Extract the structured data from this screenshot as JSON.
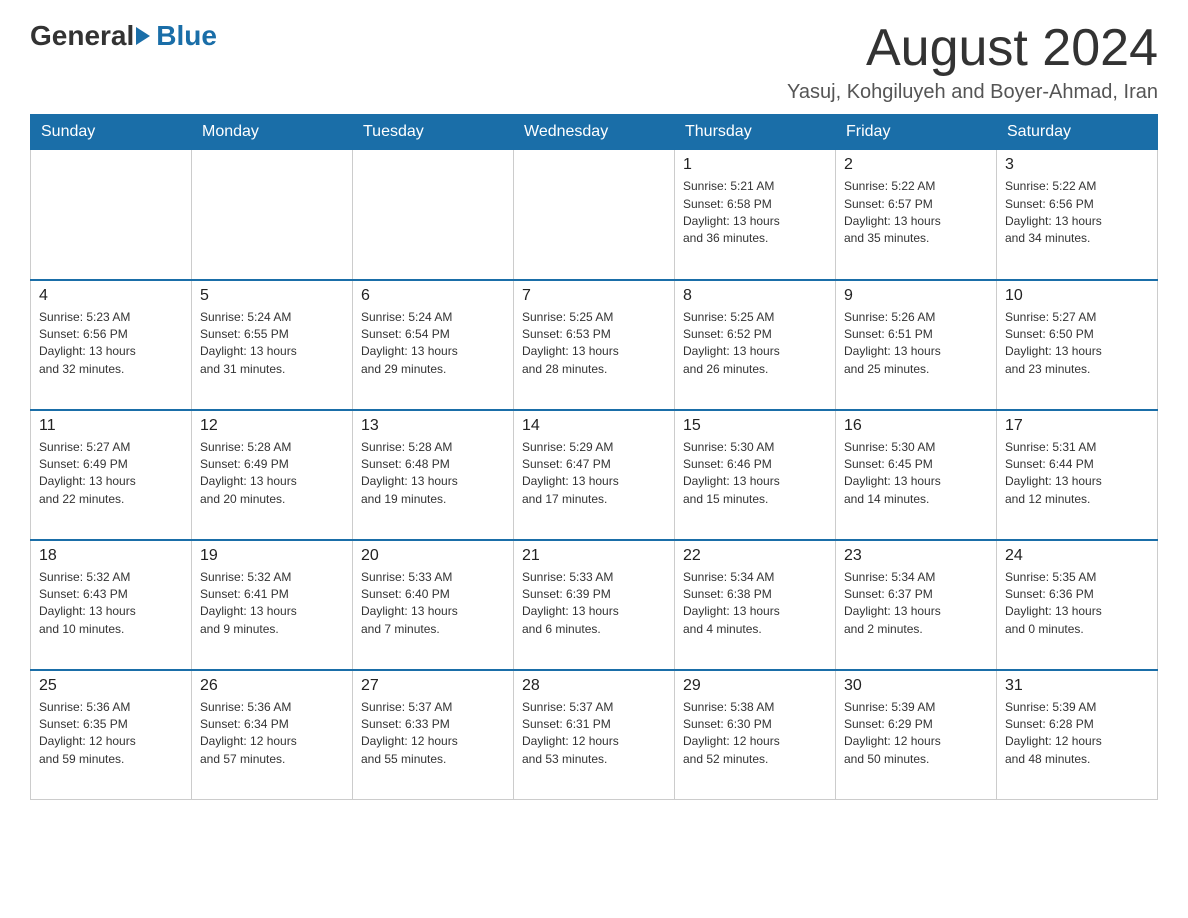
{
  "header": {
    "logo_general": "General",
    "logo_blue": "Blue",
    "month_title": "August 2024",
    "location": "Yasuj, Kohgiluyeh and Boyer-Ahmad, Iran"
  },
  "days_of_week": [
    "Sunday",
    "Monday",
    "Tuesday",
    "Wednesday",
    "Thursday",
    "Friday",
    "Saturday"
  ],
  "weeks": [
    [
      {
        "day": "",
        "info": ""
      },
      {
        "day": "",
        "info": ""
      },
      {
        "day": "",
        "info": ""
      },
      {
        "day": "",
        "info": ""
      },
      {
        "day": "1",
        "info": "Sunrise: 5:21 AM\nSunset: 6:58 PM\nDaylight: 13 hours\nand 36 minutes."
      },
      {
        "day": "2",
        "info": "Sunrise: 5:22 AM\nSunset: 6:57 PM\nDaylight: 13 hours\nand 35 minutes."
      },
      {
        "day": "3",
        "info": "Sunrise: 5:22 AM\nSunset: 6:56 PM\nDaylight: 13 hours\nand 34 minutes."
      }
    ],
    [
      {
        "day": "4",
        "info": "Sunrise: 5:23 AM\nSunset: 6:56 PM\nDaylight: 13 hours\nand 32 minutes."
      },
      {
        "day": "5",
        "info": "Sunrise: 5:24 AM\nSunset: 6:55 PM\nDaylight: 13 hours\nand 31 minutes."
      },
      {
        "day": "6",
        "info": "Sunrise: 5:24 AM\nSunset: 6:54 PM\nDaylight: 13 hours\nand 29 minutes."
      },
      {
        "day": "7",
        "info": "Sunrise: 5:25 AM\nSunset: 6:53 PM\nDaylight: 13 hours\nand 28 minutes."
      },
      {
        "day": "8",
        "info": "Sunrise: 5:25 AM\nSunset: 6:52 PM\nDaylight: 13 hours\nand 26 minutes."
      },
      {
        "day": "9",
        "info": "Sunrise: 5:26 AM\nSunset: 6:51 PM\nDaylight: 13 hours\nand 25 minutes."
      },
      {
        "day": "10",
        "info": "Sunrise: 5:27 AM\nSunset: 6:50 PM\nDaylight: 13 hours\nand 23 minutes."
      }
    ],
    [
      {
        "day": "11",
        "info": "Sunrise: 5:27 AM\nSunset: 6:49 PM\nDaylight: 13 hours\nand 22 minutes."
      },
      {
        "day": "12",
        "info": "Sunrise: 5:28 AM\nSunset: 6:49 PM\nDaylight: 13 hours\nand 20 minutes."
      },
      {
        "day": "13",
        "info": "Sunrise: 5:28 AM\nSunset: 6:48 PM\nDaylight: 13 hours\nand 19 minutes."
      },
      {
        "day": "14",
        "info": "Sunrise: 5:29 AM\nSunset: 6:47 PM\nDaylight: 13 hours\nand 17 minutes."
      },
      {
        "day": "15",
        "info": "Sunrise: 5:30 AM\nSunset: 6:46 PM\nDaylight: 13 hours\nand 15 minutes."
      },
      {
        "day": "16",
        "info": "Sunrise: 5:30 AM\nSunset: 6:45 PM\nDaylight: 13 hours\nand 14 minutes."
      },
      {
        "day": "17",
        "info": "Sunrise: 5:31 AM\nSunset: 6:44 PM\nDaylight: 13 hours\nand 12 minutes."
      }
    ],
    [
      {
        "day": "18",
        "info": "Sunrise: 5:32 AM\nSunset: 6:43 PM\nDaylight: 13 hours\nand 10 minutes."
      },
      {
        "day": "19",
        "info": "Sunrise: 5:32 AM\nSunset: 6:41 PM\nDaylight: 13 hours\nand 9 minutes."
      },
      {
        "day": "20",
        "info": "Sunrise: 5:33 AM\nSunset: 6:40 PM\nDaylight: 13 hours\nand 7 minutes."
      },
      {
        "day": "21",
        "info": "Sunrise: 5:33 AM\nSunset: 6:39 PM\nDaylight: 13 hours\nand 6 minutes."
      },
      {
        "day": "22",
        "info": "Sunrise: 5:34 AM\nSunset: 6:38 PM\nDaylight: 13 hours\nand 4 minutes."
      },
      {
        "day": "23",
        "info": "Sunrise: 5:34 AM\nSunset: 6:37 PM\nDaylight: 13 hours\nand 2 minutes."
      },
      {
        "day": "24",
        "info": "Sunrise: 5:35 AM\nSunset: 6:36 PM\nDaylight: 13 hours\nand 0 minutes."
      }
    ],
    [
      {
        "day": "25",
        "info": "Sunrise: 5:36 AM\nSunset: 6:35 PM\nDaylight: 12 hours\nand 59 minutes."
      },
      {
        "day": "26",
        "info": "Sunrise: 5:36 AM\nSunset: 6:34 PM\nDaylight: 12 hours\nand 57 minutes."
      },
      {
        "day": "27",
        "info": "Sunrise: 5:37 AM\nSunset: 6:33 PM\nDaylight: 12 hours\nand 55 minutes."
      },
      {
        "day": "28",
        "info": "Sunrise: 5:37 AM\nSunset: 6:31 PM\nDaylight: 12 hours\nand 53 minutes."
      },
      {
        "day": "29",
        "info": "Sunrise: 5:38 AM\nSunset: 6:30 PM\nDaylight: 12 hours\nand 52 minutes."
      },
      {
        "day": "30",
        "info": "Sunrise: 5:39 AM\nSunset: 6:29 PM\nDaylight: 12 hours\nand 50 minutes."
      },
      {
        "day": "31",
        "info": "Sunrise: 5:39 AM\nSunset: 6:28 PM\nDaylight: 12 hours\nand 48 minutes."
      }
    ]
  ]
}
